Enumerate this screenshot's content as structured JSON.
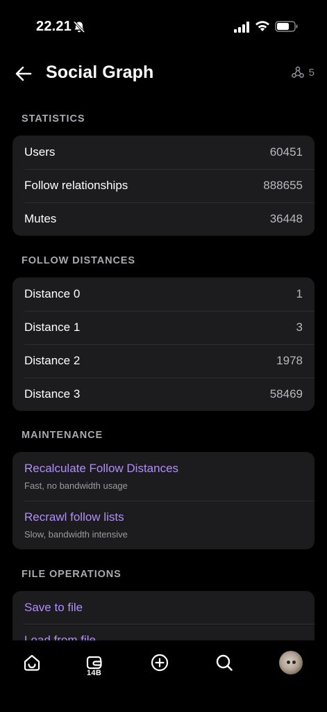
{
  "status_bar": {
    "time": "22.21"
  },
  "header": {
    "title": "Social Graph",
    "peer_count": "5"
  },
  "sections": {
    "statistics": {
      "label": "STATISTICS",
      "rows": [
        {
          "label": "Users",
          "value": "60451"
        },
        {
          "label": "Follow relationships",
          "value": "888655"
        },
        {
          "label": "Mutes",
          "value": "36448"
        }
      ]
    },
    "follow_distances": {
      "label": "FOLLOW DISTANCES",
      "rows": [
        {
          "label": "Distance 0",
          "value": "1"
        },
        {
          "label": "Distance 1",
          "value": "3"
        },
        {
          "label": "Distance 2",
          "value": "1978"
        },
        {
          "label": "Distance 3",
          "value": "58469"
        }
      ]
    },
    "maintenance": {
      "label": "MAINTENANCE",
      "actions": [
        {
          "label": "Recalculate Follow Distances",
          "sub": "Fast, no bandwidth usage"
        },
        {
          "label": "Recrawl follow lists",
          "sub": "Slow, bandwidth intensive"
        }
      ]
    },
    "file_operations": {
      "label": "FILE OPERATIONS",
      "actions": [
        {
          "label": "Save to file"
        },
        {
          "label": "Load from file"
        }
      ]
    }
  },
  "tabbar": {
    "wallet_badge": "14B"
  },
  "colors": {
    "accent": "#b18ef7",
    "card": "#1c1c1e",
    "background": "#000000",
    "muted": "#a9a9b0"
  }
}
